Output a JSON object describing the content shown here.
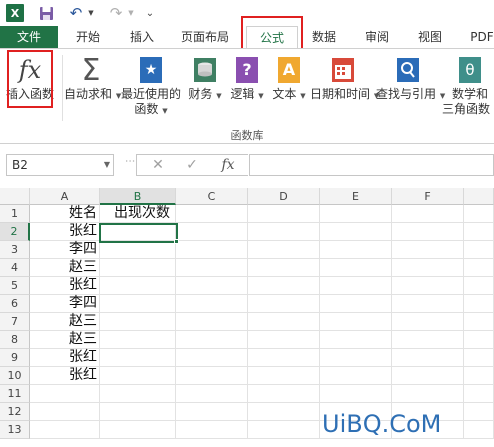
{
  "qat": {
    "app_icon": "excel-logo-icon",
    "app_letter": "X",
    "icons": [
      "save-icon",
      "undo-icon",
      "redo-icon",
      "customize-qat-icon"
    ]
  },
  "tabs": {
    "file": "文件",
    "home": "开始",
    "insert": "插入",
    "page_layout": "页面布局",
    "formulas": "公式",
    "data": "数据",
    "review": "审阅",
    "view": "视图",
    "pdf": "PDF"
  },
  "ribbon": {
    "insert_function": "插入函数",
    "autosum_line1": "自动求和",
    "recent_line1": "最近使用的",
    "recent_line2": "函数",
    "financial": "财务",
    "logical": "逻辑",
    "text": "文本",
    "datetime": "日期和时间",
    "lookup": "查找与引用",
    "math_line1": "数学和",
    "math_line2": "三角函数",
    "group_label": "函数库",
    "fx_glyph": "fx",
    "sigma_glyph": "Σ",
    "star_glyph": "★",
    "question_glyph": "?",
    "text_glyph": "A",
    "theta_glyph": "θ"
  },
  "formula_bar": {
    "name_box": "B2",
    "cancel": "✕",
    "enter": "✓",
    "fx": "fx",
    "value": ""
  },
  "grid": {
    "columns": [
      "A",
      "B",
      "C",
      "D",
      "E",
      "F"
    ],
    "rows": [
      "1",
      "2",
      "3",
      "4",
      "5",
      "6",
      "7",
      "8",
      "9",
      "10",
      "11",
      "12",
      "13"
    ],
    "column_a": [
      "姓名",
      "张红",
      "李四",
      "赵三",
      "张红",
      "李四",
      "赵三",
      "赵三",
      "张红",
      "张红"
    ],
    "b1": "出现次数",
    "selected_column": "B",
    "selected_row": "2"
  },
  "watermark": "UiBQ.CoM",
  "colors": {
    "excel_green": "#217346",
    "highlight_red": "#e02020"
  }
}
